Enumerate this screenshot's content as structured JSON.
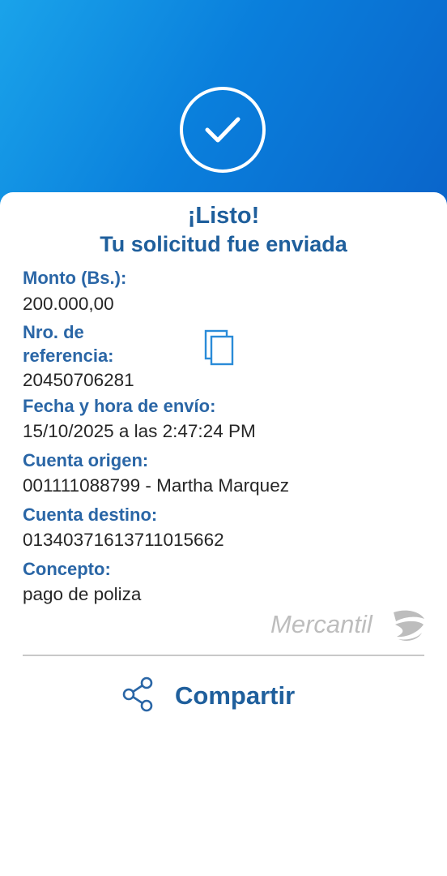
{
  "success": {
    "title": "¡Listo!",
    "subtitle": "Tu solicitud fue enviada"
  },
  "fields": {
    "amount": {
      "label": "Monto (Bs.):",
      "value": "200.000,00"
    },
    "reference": {
      "label_line1": "Nro. de",
      "label_line2": "referencia:",
      "value": "20450706281"
    },
    "datetime": {
      "label": "Fecha y hora de envío:",
      "value": "15/10/2025 a las 2:47:24 PM"
    },
    "source_account": {
      "label": "Cuenta origen:",
      "value": "001111088799 - Martha Marquez"
    },
    "destination_account": {
      "label": "Cuenta destino:",
      "value": "01340371613711015662"
    },
    "concept": {
      "label": "Concepto:",
      "value": "pago de poliza"
    }
  },
  "brand": {
    "name": "Mercantil"
  },
  "actions": {
    "share_label": "Compartir"
  },
  "icons": {
    "success": "check-circle-icon",
    "copy": "copy-icon",
    "share": "share-icon"
  },
  "colors": {
    "header_gradient_start": "#1aa3ea",
    "header_gradient_end": "#0a63c9",
    "label_blue": "#2a66a6",
    "title_blue": "#1f5f9c",
    "text": "#262626"
  }
}
